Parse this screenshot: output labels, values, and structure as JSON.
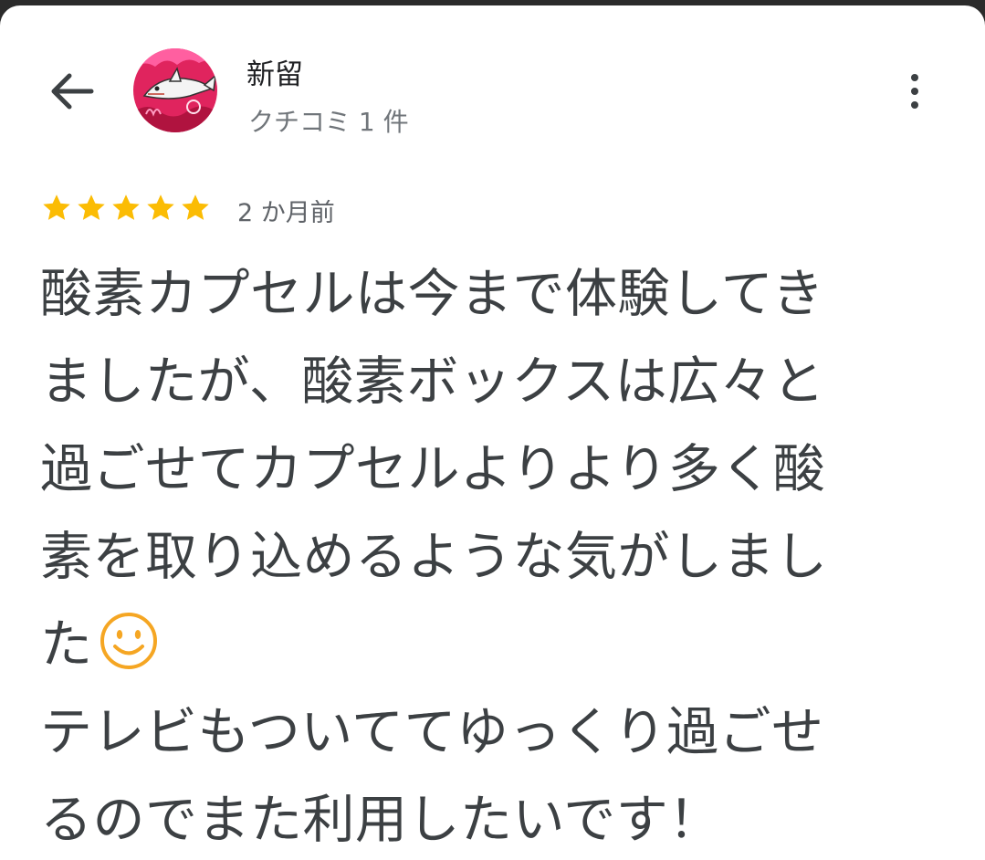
{
  "reviewer": {
    "name": "新留",
    "review_count": "クチコミ 1 件"
  },
  "review": {
    "rating": 5,
    "max_rating": 5,
    "time": "2 か月前",
    "lines": [
      "酸素カプセルは今まで体験してき",
      "ましたが、酸素ボックスは広々と",
      "過ごせてカプセルよりより多く酸",
      "素を取り込めるような気がしまし",
      "た",
      "テレビもついててゆっくり過ごせ",
      "るのでまた利用したいです！"
    ]
  },
  "icons": {
    "back": "arrow-back-icon",
    "more": "more-vert-icon",
    "star": "star-icon",
    "emoji": "smiling-face-emoji"
  },
  "colors": {
    "star": "#fbbc04",
    "emoji": "#f5a623",
    "avatar_bg": "#e0245e"
  }
}
